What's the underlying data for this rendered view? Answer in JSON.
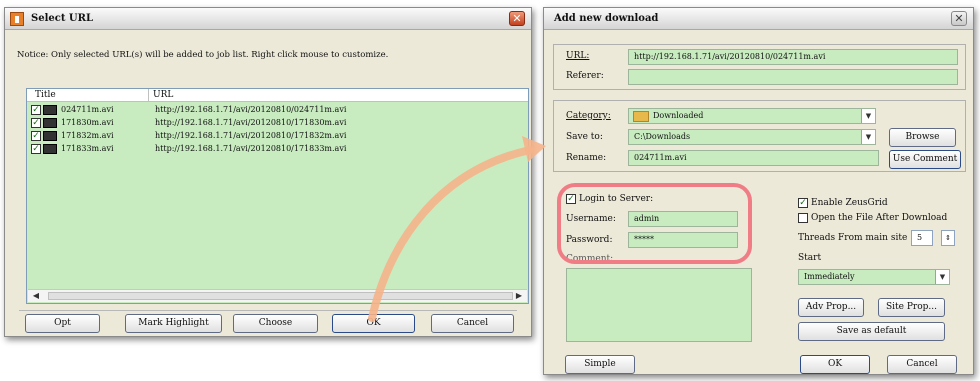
{
  "select_dialog": {
    "title": "Select URL",
    "notice": "Notice: Only selected URL(s) will be added to job list. Right click mouse to customize.",
    "columns": [
      "Title",
      "URL"
    ],
    "rows": [
      {
        "checked": true,
        "title": "024711m.avi",
        "url": "http://192.168.1.71/avi/20120810/024711m.avi"
      },
      {
        "checked": true,
        "title": "171830m.avi",
        "url": "http://192.168.1.71/avi/20120810/171830m.avi"
      },
      {
        "checked": true,
        "title": "171832m.avi",
        "url": "http://192.168.1.71/avi/20120810/171832m.avi"
      },
      {
        "checked": true,
        "title": "171833m.avi",
        "url": "http://192.168.1.71/avi/20120810/171833m.avi"
      }
    ],
    "buttons": {
      "opt": "Opt",
      "mark_highlight": "Mark Highlight",
      "choose": "Choose",
      "ok": "OK",
      "cancel": "Cancel"
    },
    "close_glyph": "✕"
  },
  "add_dialog": {
    "title": "Add new download",
    "url_label": "URL:",
    "url_value": "http://192.168.1.71/avi/20120810/024711m.avi",
    "referer_label": "Referer:",
    "referer_value": "",
    "category_label": "Category:",
    "category_value": "Downloaded",
    "save_to_label": "Save to:",
    "save_to_value": "C:\\Downloads",
    "browse_label": "Browse",
    "rename_label": "Rename:",
    "rename_value": "024711m.avi",
    "use_comment_label": "Use Comment",
    "login": {
      "checkbox_label": "Login to Server:",
      "checked": true,
      "username_label": "Username:",
      "username_value": "admin",
      "password_label": "Password:",
      "password_value": "*****"
    },
    "comment_label": "Comment:",
    "enable_label": "Enable ZeusGrid",
    "enable_checked": true,
    "open_file_label": "Open the File After Download",
    "open_file_checked": false,
    "threads_label": "Threads From main site",
    "threads_value": "5",
    "start_label": "Start",
    "start_value": "Immediately",
    "adv_prop_label": "Adv Prop...",
    "site_prop_label": "Site Prop...",
    "save_default_label": "Save as default",
    "simple_label": "Simple",
    "ok_label": "OK",
    "cancel_label": "Cancel",
    "close_glyph": "✕"
  },
  "colors": {
    "dialog_bg": "#ece9d8",
    "field_green": "#c8ecc0",
    "highlight_outline": "#f07c86",
    "arrow": "#f5b48a",
    "close_red": "#c2401e"
  }
}
